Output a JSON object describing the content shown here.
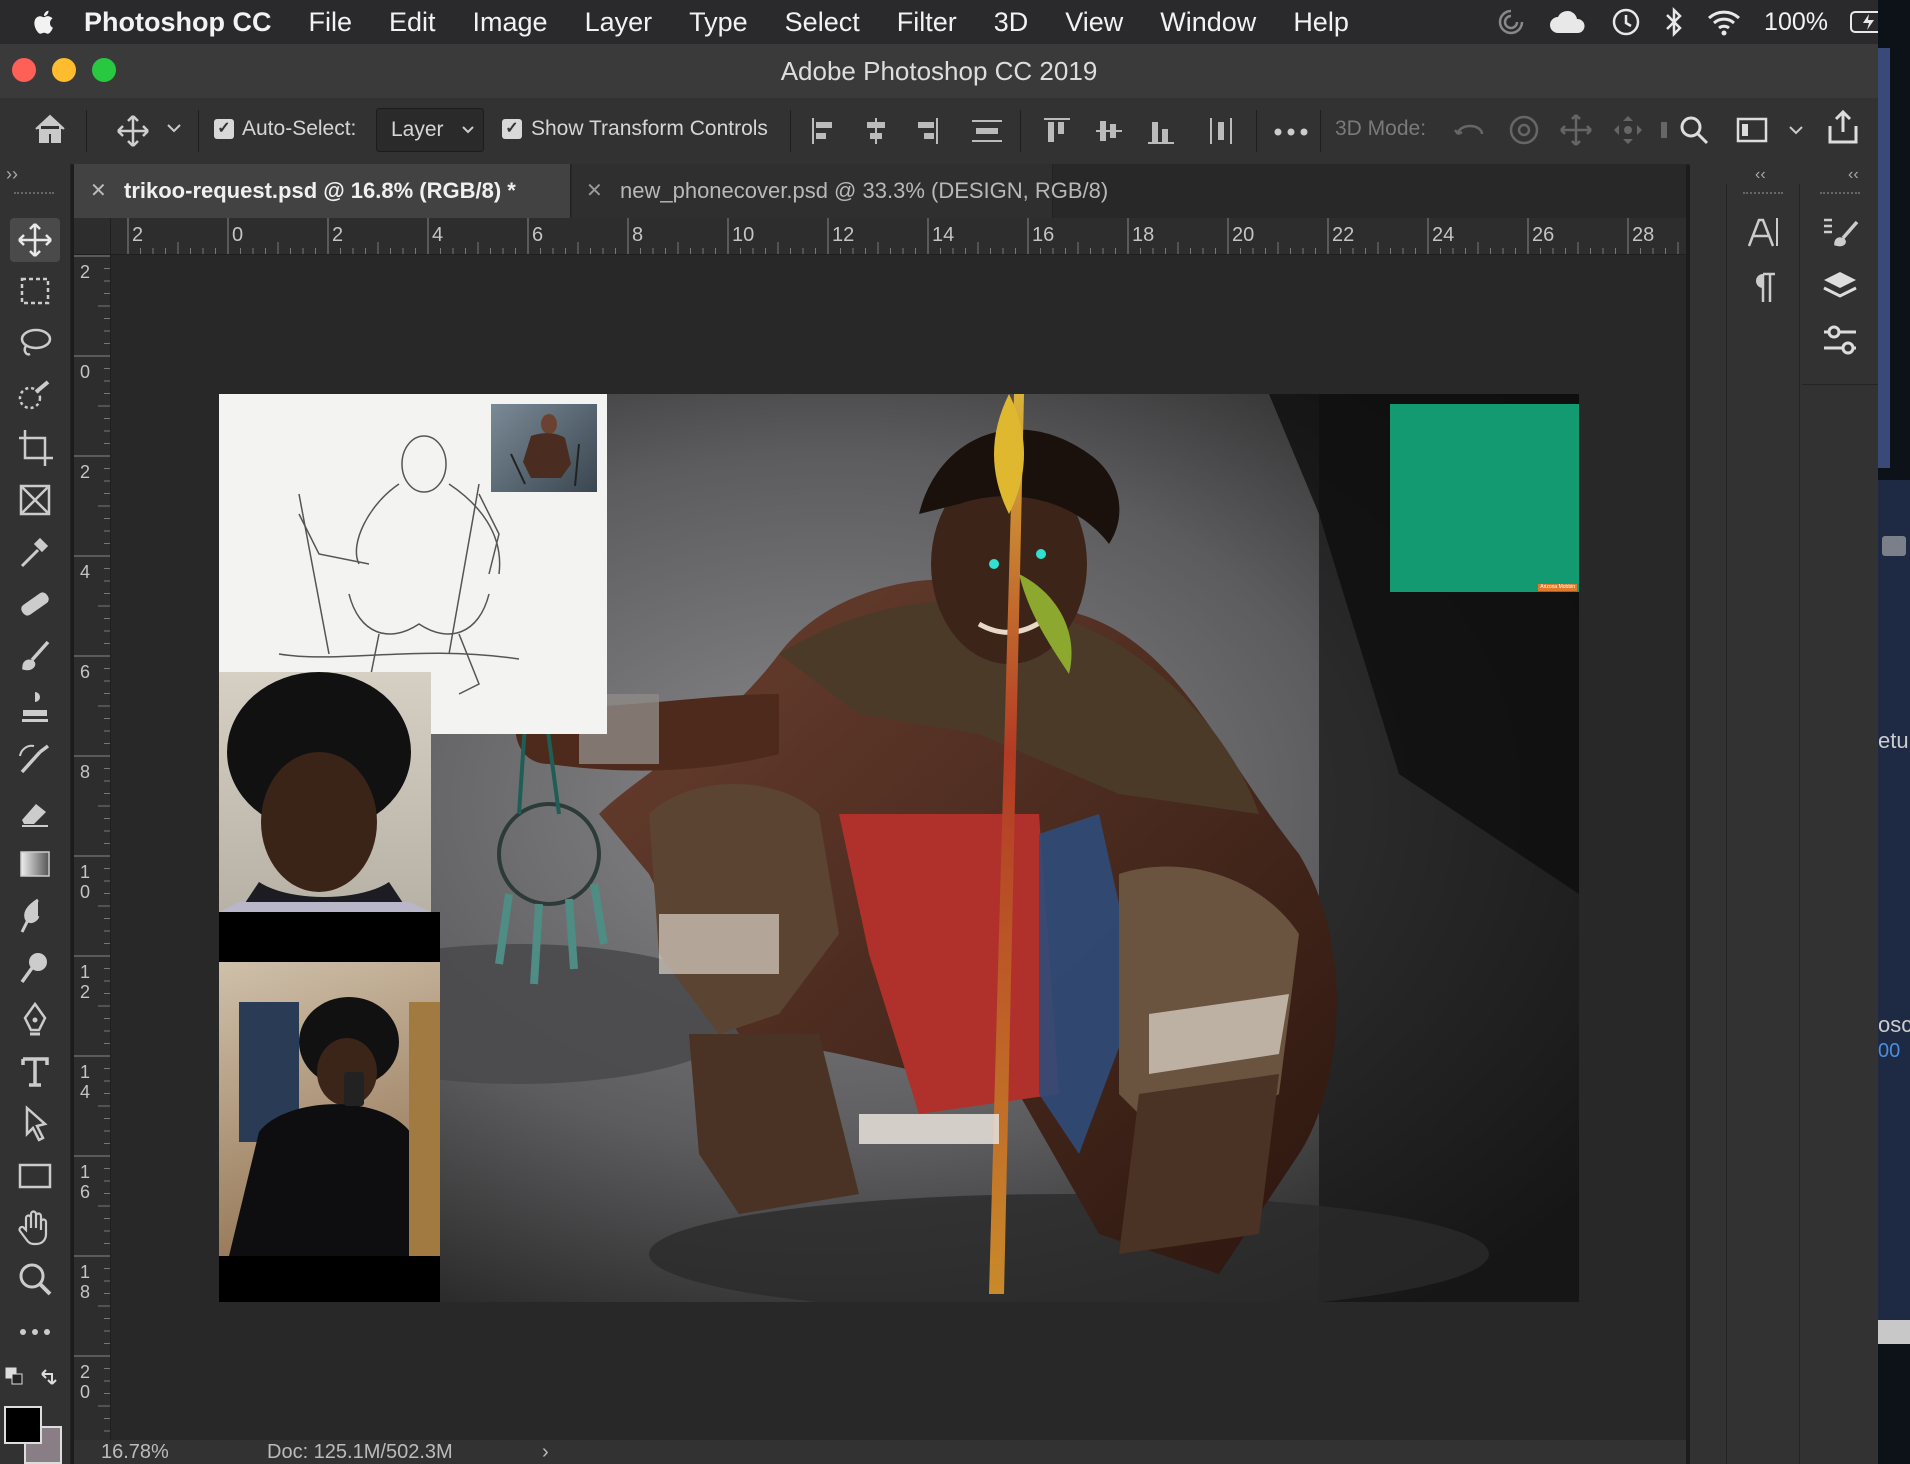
{
  "menubar": {
    "app_name": "Photoshop CC",
    "items": [
      "File",
      "Edit",
      "Image",
      "Layer",
      "Type",
      "Select",
      "Filter",
      "3D",
      "View",
      "Window",
      "Help"
    ],
    "battery": "100%"
  },
  "window": {
    "title": "Adobe Photoshop CC 2019"
  },
  "options": {
    "auto_select_label": "Auto-Select:",
    "auto_select_value": "Layer",
    "show_transform_label": "Show Transform Controls",
    "mode_3d_label": "3D Mode:"
  },
  "tabs": [
    {
      "label": "trikoo-request.psd @ 16.8% (RGB/8) *",
      "active": true
    },
    {
      "label": "new_phonecover.psd @ 33.3% (DESIGN, RGB/8)",
      "active": false
    }
  ],
  "ruler": {
    "h_ticks": [
      "2",
      "0",
      "2",
      "4",
      "6",
      "8",
      "10",
      "12",
      "14",
      "16",
      "18",
      "20",
      "22",
      "24",
      "26",
      "28"
    ],
    "v_ticks": [
      "2",
      "0",
      "2",
      "4",
      "6",
      "8",
      "1 0",
      "1 2",
      "1 4",
      "1 6",
      "1 8",
      "2 0"
    ]
  },
  "canvas": {
    "swatch_color": "#139a70",
    "swatch_credit": "Arizona Mobbin"
  },
  "status": {
    "zoom": "16.78%",
    "doc": "Doc: 125.1M/502.3M"
  },
  "desktop_peek": {
    "text1": "etu",
    "text2": "osc",
    "text3": "00"
  },
  "colors": {
    "foreground": "#000000",
    "background": "#8a7e86"
  }
}
